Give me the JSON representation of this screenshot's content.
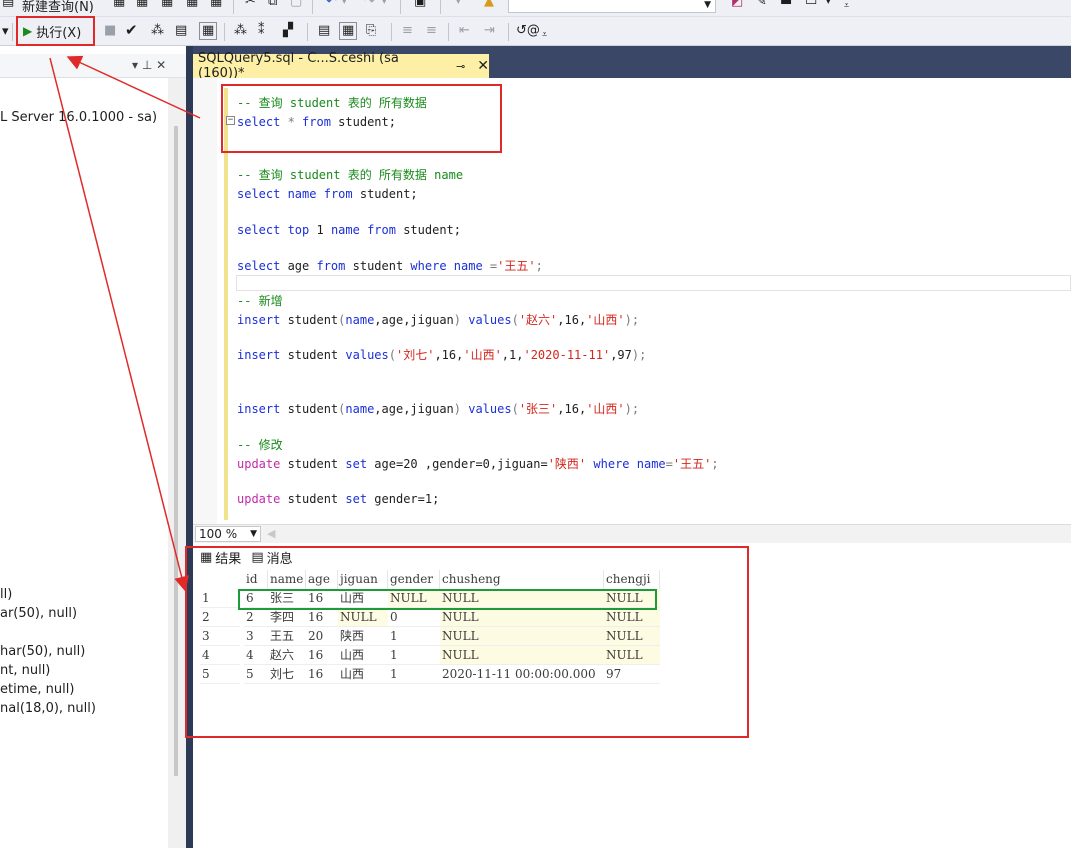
{
  "toolbar": {
    "new_query_label": "新建查询(N)",
    "execute_label": "执行(X)",
    "icons": [
      "new-query-icon",
      "mdx-query-icon",
      "dmx-query-icon",
      "xmla-query-icon",
      "dax-query-icon",
      "cut-icon",
      "copy-icon",
      "paste-icon",
      "undo-icon",
      "redo-icon",
      "save-icon",
      "database-combo",
      "settings-icon",
      "search-icon",
      "properties-icon",
      "window-icon",
      "check-icon",
      "debug-icon",
      "parse-icon",
      "results-to-text-icon",
      "results-to-grid-icon",
      "results-to-file-icon",
      "comment-icon",
      "uncomment-icon",
      "indent-icon",
      "outdent-icon",
      "specify-values-icon"
    ]
  },
  "explorer": {
    "panel_controls": "▾ ⊥ ✕",
    "server_label": "L Server 16.0.1000 - sa)",
    "columns": [
      "ll)",
      "ar(50), null)",
      "har(50), null)",
      "nt, null)",
      "etime, null)",
      "nal(18,0), null)"
    ]
  },
  "tab": {
    "title": "SQLQuery5.sql - C...S.ceshi (sa (160))*",
    "pin": "⊸",
    "close": "✕"
  },
  "editor": {
    "lines": [
      {
        "parts": [
          {
            "t": "-- 查询 student 表的 所有数据",
            "c": "cm"
          }
        ]
      },
      {
        "parts": [
          {
            "t": "select",
            "c": "kw"
          },
          {
            "t": " * ",
            "c": "gr"
          },
          {
            "t": "from",
            "c": "kw"
          },
          {
            "t": " student;",
            "c": ""
          }
        ]
      },
      {
        "parts": [
          {
            "t": "-- 查询 student 表的 所有数据 name",
            "c": "cm"
          }
        ]
      },
      {
        "parts": [
          {
            "t": "select",
            "c": "kw"
          },
          {
            "t": " name ",
            "c": "kw"
          },
          {
            "t": "from",
            "c": "kw"
          },
          {
            "t": " student;",
            "c": ""
          }
        ]
      },
      {
        "parts": [
          {
            "t": "select",
            "c": "kw"
          },
          {
            "t": " top ",
            "c": "kw"
          },
          {
            "t": "1 ",
            "c": ""
          },
          {
            "t": "name ",
            "c": "kw"
          },
          {
            "t": "from",
            "c": "kw"
          },
          {
            "t": " student;",
            "c": ""
          }
        ]
      },
      {
        "parts": [
          {
            "t": "select",
            "c": "kw"
          },
          {
            "t": " age ",
            "c": ""
          },
          {
            "t": "from",
            "c": "kw"
          },
          {
            "t": " student ",
            "c": ""
          },
          {
            "t": "where",
            "c": "kw"
          },
          {
            "t": " name ",
            "c": "kw"
          },
          {
            "t": "=",
            "c": "gr"
          },
          {
            "t": "'王五'",
            "c": "str"
          },
          {
            "t": ";",
            "c": "gr"
          }
        ]
      },
      {
        "parts": [
          {
            "t": "-- 新增",
            "c": "cm"
          }
        ]
      },
      {
        "parts": [
          {
            "t": "insert",
            "c": "kw"
          },
          {
            "t": " student",
            "c": ""
          },
          {
            "t": "(",
            "c": "gr"
          },
          {
            "t": "name",
            "c": "kw"
          },
          {
            "t": ",age,jiguan",
            "c": ""
          },
          {
            "t": ") ",
            "c": "gr"
          },
          {
            "t": "values",
            "c": "kw"
          },
          {
            "t": "(",
            "c": "gr"
          },
          {
            "t": "'赵六'",
            "c": "str"
          },
          {
            "t": ",16,",
            "c": ""
          },
          {
            "t": "'山西'",
            "c": "str"
          },
          {
            "t": ");",
            "c": "gr"
          }
        ]
      },
      {
        "parts": [
          {
            "t": "insert",
            "c": "kw"
          },
          {
            "t": " student ",
            "c": ""
          },
          {
            "t": "values",
            "c": "kw"
          },
          {
            "t": "(",
            "c": "gr"
          },
          {
            "t": "'刘七'",
            "c": "str"
          },
          {
            "t": ",16,",
            "c": ""
          },
          {
            "t": "'山西'",
            "c": "str"
          },
          {
            "t": ",1,",
            "c": ""
          },
          {
            "t": "'2020-11-11'",
            "c": "str"
          },
          {
            "t": ",97",
            "c": ""
          },
          {
            "t": ");",
            "c": "gr"
          }
        ]
      },
      {
        "parts": [
          {
            "t": "insert",
            "c": "kw"
          },
          {
            "t": " student",
            "c": ""
          },
          {
            "t": "(",
            "c": "gr"
          },
          {
            "t": "name",
            "c": "kw"
          },
          {
            "t": ",age,jiguan",
            "c": ""
          },
          {
            "t": ") ",
            "c": "gr"
          },
          {
            "t": "values",
            "c": "kw"
          },
          {
            "t": "(",
            "c": "gr"
          },
          {
            "t": "'张三'",
            "c": "str"
          },
          {
            "t": ",16,",
            "c": ""
          },
          {
            "t": "'山西'",
            "c": "str"
          },
          {
            "t": ");",
            "c": "gr"
          }
        ]
      },
      {
        "parts": [
          {
            "t": "-- 修改",
            "c": "cm"
          }
        ]
      },
      {
        "parts": [
          {
            "t": "update",
            "c": "pink"
          },
          {
            "t": " student ",
            "c": ""
          },
          {
            "t": "set",
            "c": "kw"
          },
          {
            "t": " age=20 ,gender=0,jiguan=",
            "c": ""
          },
          {
            "t": "'陕西'",
            "c": "str"
          },
          {
            "t": " ",
            "c": ""
          },
          {
            "t": "where",
            "c": "kw"
          },
          {
            "t": " ",
            "c": ""
          },
          {
            "t": "name",
            "c": "kw"
          },
          {
            "t": "=",
            "c": "gr"
          },
          {
            "t": "'王五'",
            "c": "str"
          },
          {
            "t": ";",
            "c": "gr"
          }
        ]
      },
      {
        "parts": [
          {
            "t": "update",
            "c": "pink"
          },
          {
            "t": " student ",
            "c": ""
          },
          {
            "t": "set",
            "c": "kw"
          },
          {
            "t": " gender=1;",
            "c": ""
          }
        ]
      }
    ]
  },
  "zoom": {
    "value": "100 %"
  },
  "results": {
    "tabs": [
      {
        "label": "结果",
        "icon": "grid-icon"
      },
      {
        "label": "消息",
        "icon": "messages-icon"
      }
    ],
    "columns": [
      "id",
      "name",
      "age",
      "jiguan",
      "gender",
      "chusheng",
      "chengji"
    ],
    "rows": [
      [
        "1",
        "6",
        "张三",
        "16",
        "山西",
        "NULL",
        "NULL",
        "NULL"
      ],
      [
        "2",
        "2",
        "李四",
        "16",
        "NULL",
        "0",
        "NULL",
        "NULL"
      ],
      [
        "3",
        "3",
        "王五",
        "20",
        "陕西",
        "1",
        "NULL",
        "NULL"
      ],
      [
        "4",
        "4",
        "赵六",
        "16",
        "山西",
        "1",
        "NULL",
        "NULL"
      ],
      [
        "5",
        "5",
        "刘七",
        "16",
        "山西",
        "1",
        "2020-11-11 00:00:00.000",
        "97"
      ]
    ]
  },
  "colors": {
    "annotation_red": "#e02a2a",
    "annotation_green": "#1f9a3a",
    "tab_yellow": "#fdf0a6",
    "dark_chrome": "#3a4766"
  }
}
